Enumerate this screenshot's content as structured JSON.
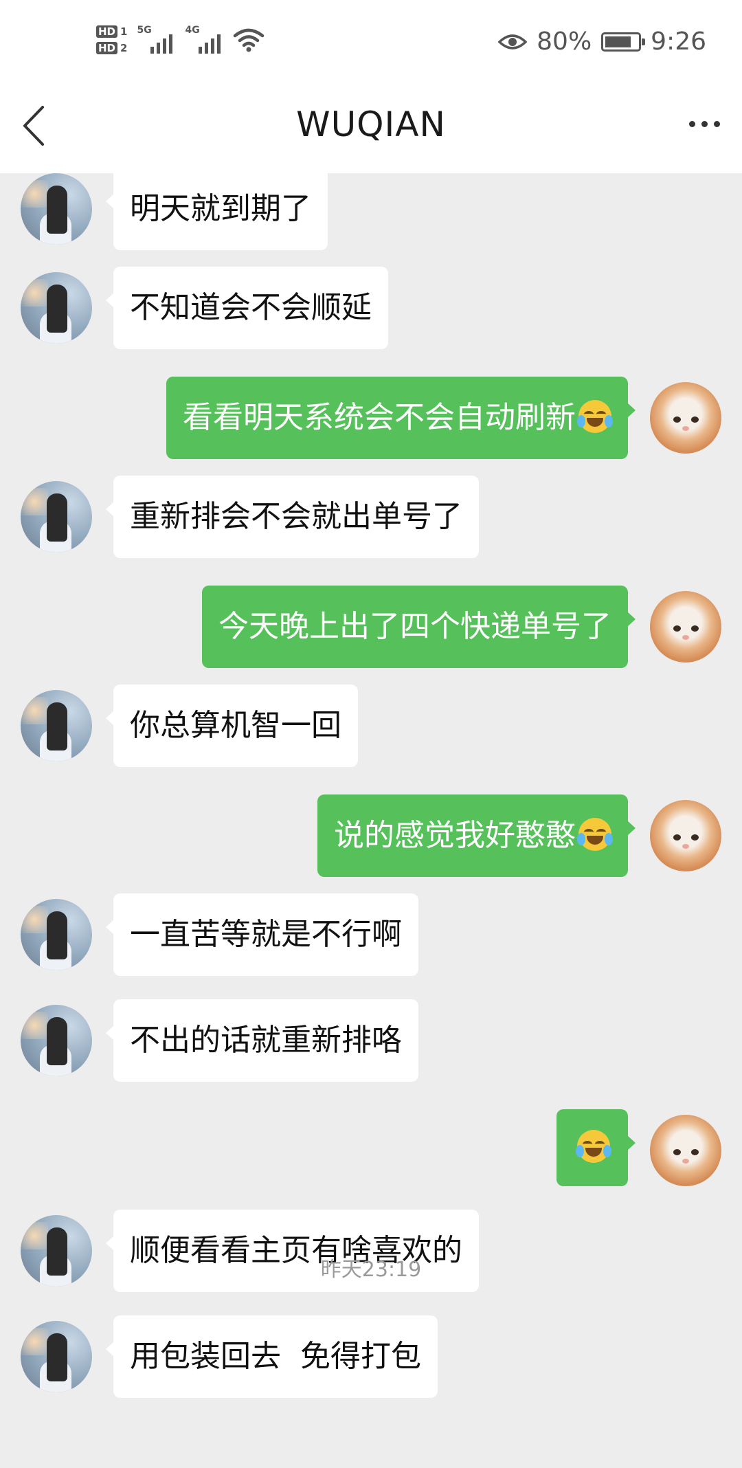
{
  "status_bar": {
    "sim1_label": "HD",
    "sim1_num": "1",
    "sim2_label": "HD",
    "sim2_num": "2",
    "net1": "5G",
    "net2": "4G",
    "battery_percent": "80%",
    "battery_level": 0.8,
    "time": "9:26"
  },
  "navbar": {
    "title": "WUQIAN"
  },
  "messages": [
    {
      "side": "in",
      "text": "明天就到期了"
    },
    {
      "side": "in",
      "text": "不知道会不会顺延"
    },
    {
      "side": "out",
      "text": "看看明天系统会不会自动刷新",
      "emoji": "laugh-cry-emoji"
    },
    {
      "side": "in",
      "text": "重新排会不会就出单号了"
    },
    {
      "side": "out",
      "text": "今天晚上出了四个快递单号了"
    },
    {
      "side": "in",
      "text": "你总算机智一回"
    },
    {
      "side": "out",
      "text": "说的感觉我好憨憨",
      "emoji": "laugh-cry-emoji"
    },
    {
      "side": "in",
      "text": "一直苦等就是不行啊"
    },
    {
      "side": "in",
      "text": "不出的话就重新排咯"
    },
    {
      "side": "out",
      "text": "",
      "emoji": "laugh-cry-emoji"
    },
    {
      "side": "in",
      "text": "顺便看看主页有啥喜欢的"
    },
    {
      "side": "in",
      "text": "用包装回去  免得打包"
    }
  ],
  "timestamp": "昨天23:19",
  "colors": {
    "background": "#ededed",
    "incoming_bubble": "#ffffff",
    "outgoing_bubble": "#56c15a"
  }
}
